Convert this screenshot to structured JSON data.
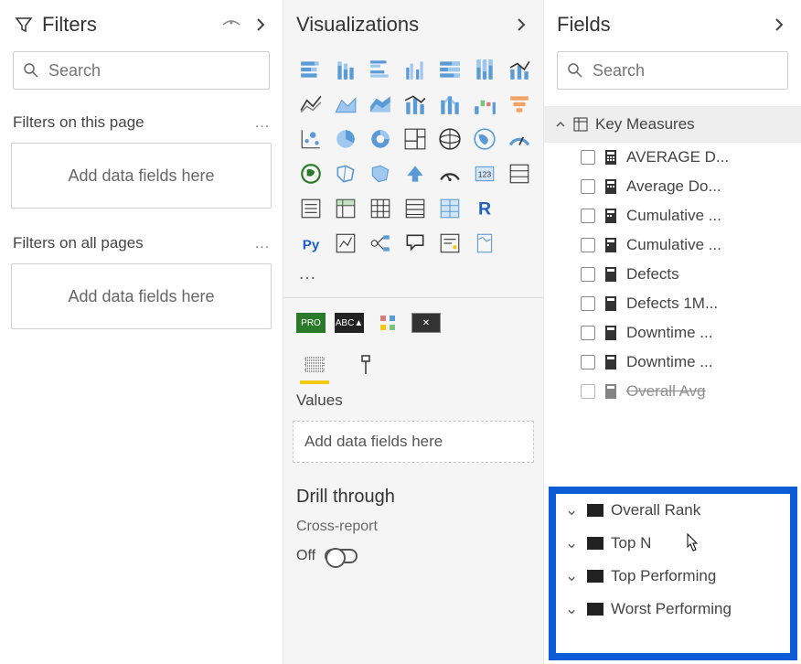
{
  "filters": {
    "title": "Filters",
    "search_placeholder": "Search",
    "section_page": "Filters on this page",
    "section_all": "Filters on all pages",
    "drop_text": "Add data fields here"
  },
  "viz": {
    "title": "Visualizations",
    "more": "…",
    "values_label": "Values",
    "drop_text": "Add data fields here",
    "drill_title": "Drill through",
    "cross_report": "Cross-report",
    "toggle_state": "Off"
  },
  "fields": {
    "title": "Fields",
    "search_placeholder": "Search",
    "group": "Key Measures",
    "items": [
      "AVERAGE D...",
      "Average Do...",
      "Cumulative ...",
      "Cumulative ...",
      "Defects",
      "Defects 1M...",
      "Downtime ...",
      "Downtime ...",
      "Overall Avg"
    ],
    "folders": [
      "Overall Rank",
      "Top N",
      "Top Performing",
      "Worst Performing"
    ]
  }
}
